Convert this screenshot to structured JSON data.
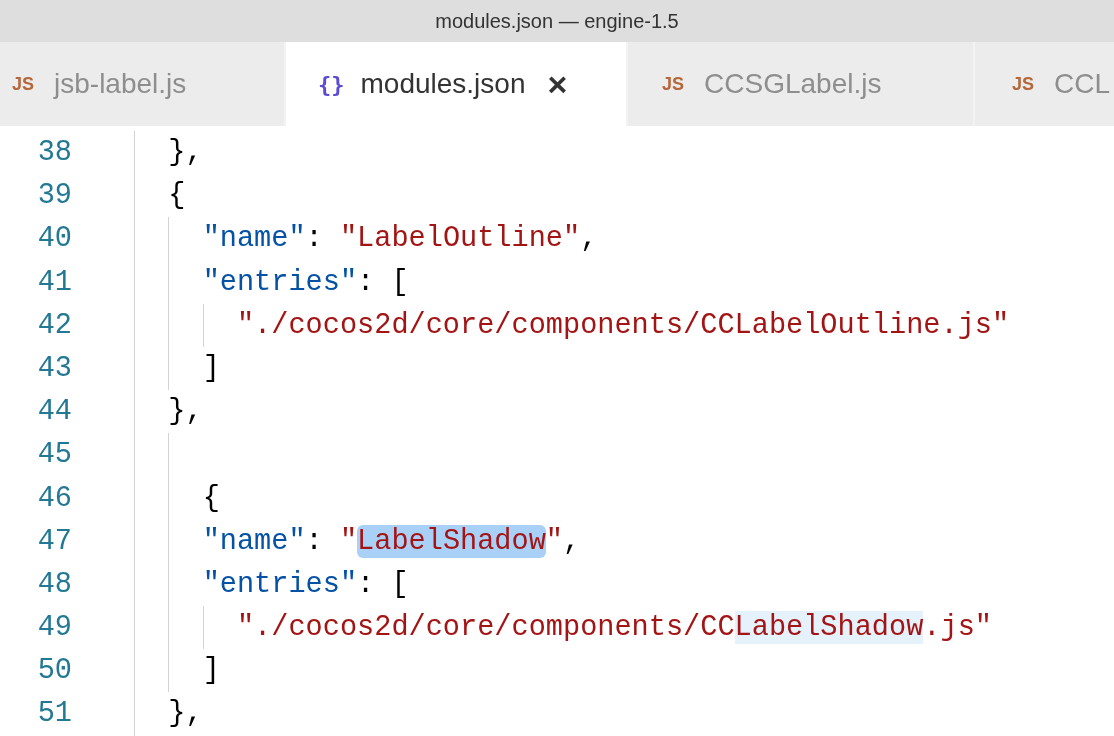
{
  "window": {
    "title": "modules.json — engine-1.5"
  },
  "tabs": [
    {
      "icon": "JS",
      "kind": "js",
      "label": "jsb-label.js",
      "selected": false
    },
    {
      "icon": "{}",
      "kind": "json",
      "label": "modules.json",
      "selected": true,
      "close": "×"
    },
    {
      "icon": "JS",
      "kind": "js",
      "label": "CCSGLabel.js",
      "selected": false
    },
    {
      "icon": "JS",
      "kind": "js",
      "label": "CCL",
      "selected": false
    }
  ],
  "editor": {
    "lines": [
      {
        "number": "38",
        "tokens": [
          {
            "kind": "punct",
            "text": "  },"
          }
        ]
      },
      {
        "number": "39",
        "tokens": [
          {
            "kind": "punct",
            "text": "  {"
          }
        ]
      },
      {
        "number": "40",
        "tokens": [
          {
            "kind": "key",
            "text": "    \"name\""
          },
          {
            "kind": "punct",
            "text": ": "
          },
          {
            "kind": "string",
            "text": "\"LabelOutline\""
          },
          {
            "kind": "punct",
            "text": ","
          }
        ]
      },
      {
        "number": "41",
        "tokens": [
          {
            "kind": "key",
            "text": "    \"entries\""
          },
          {
            "kind": "punct",
            "text": ": ["
          }
        ]
      },
      {
        "number": "42",
        "tokens": [
          {
            "kind": "string",
            "text": "      \"./cocos2d/core/components/CCLabelOutline.js\""
          }
        ]
      },
      {
        "number": "43",
        "tokens": [
          {
            "kind": "punct",
            "text": "    ]"
          }
        ]
      },
      {
        "number": "44",
        "tokens": [
          {
            "kind": "punct",
            "text": "  },"
          }
        ]
      },
      {
        "number": "45"
      },
      {
        "number": "46",
        "tokens": [
          {
            "kind": "punct",
            "text": "    {"
          }
        ]
      },
      {
        "number": "47",
        "tokens": [
          {
            "kind": "key",
            "text": "    \"name\""
          },
          {
            "kind": "punct",
            "text": ": "
          },
          {
            "kind": "string",
            "text": "\""
          },
          {
            "kind": "selection",
            "text": "LabelShadow"
          },
          {
            "kind": "string",
            "text": "\""
          },
          {
            "kind": "punct",
            "text": ","
          }
        ]
      },
      {
        "number": "48",
        "tokens": [
          {
            "kind": "key",
            "text": "    \"entries\""
          },
          {
            "kind": "punct",
            "text": ": ["
          }
        ]
      },
      {
        "number": "49",
        "tokens": [
          {
            "kind": "string",
            "text": "      \"./cocos2d/core/components/CC"
          },
          {
            "kind": "match",
            "text": "LabelShadow"
          },
          {
            "kind": "string",
            "text": ".js\""
          }
        ]
      },
      {
        "number": "50",
        "tokens": [
          {
            "kind": "punct",
            "text": "    ]"
          }
        ]
      },
      {
        "number": "51",
        "tokens": [
          {
            "kind": "punct",
            "text": "  },"
          }
        ]
      }
    ]
  }
}
